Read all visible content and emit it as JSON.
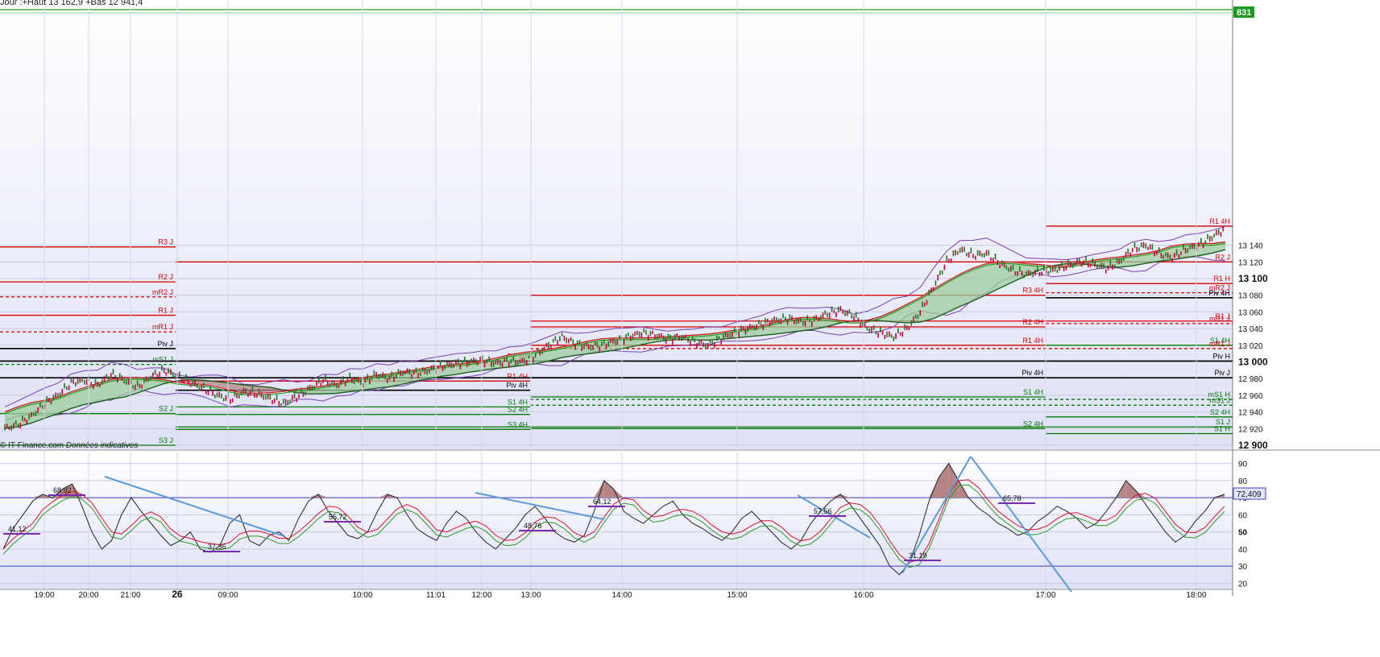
{
  "header": {
    "text": "Jour :+Haut 13 162,9 +Bas 12 941,4"
  },
  "footer": {
    "source": "© IT-Finance.com",
    "note": "Données indicatives"
  },
  "colors": {
    "resistance": "#d40000",
    "support": "#007a00",
    "pivot": "#000000",
    "price_up": "#1a7a1a",
    "price_down": "#c8003c",
    "band": "#7b3fb5",
    "cloud_bull": "#9ccc9c",
    "cloud_bear": "#b58585",
    "ma_red": "#e0102a",
    "ma_green": "#2a9a20",
    "ma_dark": "#1b5e20",
    "rsi": "#222222",
    "trend": "#5a9bd8",
    "level": "#7a2ab0"
  },
  "chart_data": [
    {
      "type": "line",
      "title": "",
      "ylim": [
        12900,
        13170
      ],
      "yticks": [
        12900,
        12920,
        12940,
        12960,
        12980,
        13000,
        13020,
        13040,
        13060,
        13080,
        13100,
        13120,
        13140
      ],
      "ytick_labels": [
        "12 900",
        "12 920",
        "12 940",
        "12 960",
        "12 980",
        "13 000",
        "13 020",
        "13 040",
        "13 060",
        "13 080",
        "13 100",
        "13 120",
        "13 140"
      ],
      "xtick_labels": [
        "19:00",
        "20:00",
        "21:00",
        "26",
        "09:00",
        "10:00",
        "11:01",
        "12:00",
        "13:00",
        "14:00",
        "15:00",
        "16:00",
        "17:00",
        "18:00"
      ],
      "last_price_label": "831",
      "price_path": [
        12920,
        12925,
        12935,
        12950,
        12960,
        12975,
        12978,
        12972,
        12985,
        12978,
        12970,
        12982,
        12990,
        12983,
        12975,
        12968,
        12960,
        12955,
        12964,
        12962,
        12956,
        12950,
        12958,
        12968,
        12978,
        12972,
        12980,
        12975,
        12985,
        12980,
        12988,
        12986,
        12990,
        12995,
        12998,
        13000,
        13002,
        12998,
        13001,
        13000,
        13008,
        13020,
        13030,
        13022,
        13018,
        13020,
        13025,
        13030,
        13035,
        13032,
        13028,
        13030,
        13024,
        13020,
        13028,
        13035,
        13040,
        13045,
        13050,
        13052,
        13048,
        13050,
        13058,
        13062,
        13055,
        13040,
        13035,
        13030,
        13040,
        13060,
        13090,
        13120,
        13135,
        13128,
        13130,
        13118,
        13110,
        13105,
        13108,
        13110,
        13115,
        13120,
        13118,
        13112,
        13120,
        13135,
        13140,
        13130,
        13125,
        13135,
        13140,
        13150,
        13160
      ],
      "series": [
        {
          "values": [
            12935,
            12948,
            12968,
            12978,
            12974,
            12962,
            12958,
            12970,
            12982,
            12988,
            12994,
            12998,
            13006,
            13020,
            13028,
            13030,
            13032,
            13030,
            13038,
            13048,
            13052,
            13048,
            13060,
            13100,
            13128,
            13124,
            13112,
            13112,
            13120,
            13132,
            13140,
            13150
          ]
        }
      ],
      "levels": [
        {
          "label": "R3 J",
          "value": 13138,
          "color": "resistance",
          "dashed": false
        },
        {
          "label": "R2 J",
          "value": 13096,
          "color": "resistance",
          "dashed": false
        },
        {
          "label": "mR2 J",
          "value": 13078,
          "color": "resistance",
          "dashed": true
        },
        {
          "label": "R1 J",
          "value": 13056,
          "color": "resistance",
          "dashed": false
        },
        {
          "label": "mR1 J",
          "value": 13036,
          "color": "resistance",
          "dashed": true
        },
        {
          "label": "Piv J",
          "value": 13016,
          "color": "pivot",
          "dashed": false
        },
        {
          "label": "mS1 J",
          "value": 12997,
          "color": "support",
          "dashed": true
        },
        {
          "label": "S2 J",
          "value": 12938,
          "color": "support",
          "dashed": false
        },
        {
          "label": "S3 J",
          "value": 12900,
          "color": "support",
          "dashed": false
        },
        {
          "label": "R2 4H",
          "value": 13001,
          "color": "resistance",
          "dashed": false
        },
        {
          "label": "R1 4H",
          "value": 12977,
          "color": "resistance",
          "dashed": false
        },
        {
          "label": "Piv 4H",
          "value": 12966,
          "color": "pivot",
          "dashed": false
        },
        {
          "label": "S1 4H",
          "value": 12946,
          "color": "support",
          "dashed": false
        },
        {
          "label": "S2 4H",
          "value": 12937,
          "color": "support",
          "dashed": false
        },
        {
          "label": "S3 4H",
          "value": 12919,
          "color": "support",
          "dashed": false
        },
        {
          "label": "R3 4H",
          "value": 13080,
          "color": "resistance",
          "dashed": false
        },
        {
          "label": "R2 4H",
          "value": 13042,
          "color": "resistance",
          "dashed": false
        },
        {
          "label": "R1 4H",
          "value": 13020,
          "color": "resistance",
          "dashed": false
        },
        {
          "label": "Piv 4H",
          "value": 12981,
          "color": "pivot",
          "dashed": false
        },
        {
          "label": "S1 4H",
          "value": 12958,
          "color": "support",
          "dashed": false
        },
        {
          "label": "S2 4H",
          "value": 12920,
          "color": "support",
          "dashed": false
        },
        {
          "label": "R1 4H",
          "value": 13163,
          "color": "resistance",
          "dashed": false
        },
        {
          "label": "R2 J",
          "value": 13120,
          "color": "resistance",
          "dashed": false
        },
        {
          "label": "R1 H",
          "value": 13094,
          "color": "resistance",
          "dashed": false
        },
        {
          "label": "mR2 J",
          "value": 13083,
          "color": "resistance",
          "dashed": true
        },
        {
          "label": "Piv 4H",
          "value": 13077,
          "color": "pivot",
          "dashed": false
        },
        {
          "label": "R1 J",
          "value": 13049,
          "color": "resistance",
          "dashed": false
        },
        {
          "label": "mR1 J",
          "value": 13046,
          "color": "resistance",
          "dashed": true
        },
        {
          "label": "S1 4H",
          "value": 13020,
          "color": "support",
          "dashed": false
        },
        {
          "label": "mR1 J",
          "value": 13016,
          "color": "resistance",
          "dashed": true
        },
        {
          "label": "Piv H",
          "value": 13001,
          "color": "pivot",
          "dashed": false
        },
        {
          "label": "Piv J",
          "value": 12981,
          "color": "pivot",
          "dashed": false
        },
        {
          "label": "mS1 H",
          "value": 12955,
          "color": "support",
          "dashed": true
        },
        {
          "label": "mS1 J",
          "value": 12948,
          "color": "support",
          "dashed": true
        },
        {
          "label": "S2 4H",
          "value": 12934,
          "color": "support",
          "dashed": false
        },
        {
          "label": "S1 J",
          "value": 12922,
          "color": "support",
          "dashed": false
        },
        {
          "label": "S1 H",
          "value": 12914,
          "color": "support",
          "dashed": false
        }
      ]
    },
    {
      "type": "line",
      "title": "",
      "ylim": [
        15,
        95
      ],
      "yticks": [
        20,
        30,
        40,
        50,
        60,
        70,
        80,
        90
      ],
      "ytick_labels": [
        "20",
        "30",
        "40",
        "50",
        "60",
        "70",
        "80",
        "90"
      ],
      "current_value_label": "72,409",
      "reference_lines": [
        70,
        30
      ],
      "point_labels": [
        "68,92",
        "41,12",
        "37,36",
        "55,72",
        "48,76",
        "64,12",
        "57,56",
        "31,19",
        "65,78"
      ],
      "rsi_path": [
        40,
        52,
        60,
        68,
        72,
        70,
        75,
        78,
        65,
        50,
        40,
        45,
        60,
        70,
        62,
        55,
        48,
        42,
        45,
        50,
        40,
        38,
        42,
        55,
        60,
        45,
        42,
        48,
        50,
        45,
        58,
        68,
        72,
        62,
        55,
        48,
        46,
        50,
        62,
        72,
        70,
        60,
        52,
        48,
        45,
        55,
        62,
        58,
        50,
        44,
        40,
        46,
        52,
        60,
        65,
        58,
        50,
        46,
        44,
        48,
        62,
        80,
        75,
        62,
        58,
        55,
        60,
        65,
        68,
        60,
        55,
        52,
        48,
        45,
        50,
        58,
        62,
        56,
        50,
        44,
        40,
        45,
        55,
        62,
        68,
        72,
        66,
        58,
        50,
        42,
        30,
        25,
        32,
        48,
        68,
        82,
        90,
        80,
        70,
        64,
        60,
        55,
        52,
        48,
        50,
        56,
        60,
        65,
        62,
        58,
        52,
        55,
        62,
        70,
        80,
        74,
        66,
        58,
        50,
        44,
        48,
        56,
        62,
        70,
        72
      ]
    }
  ]
}
